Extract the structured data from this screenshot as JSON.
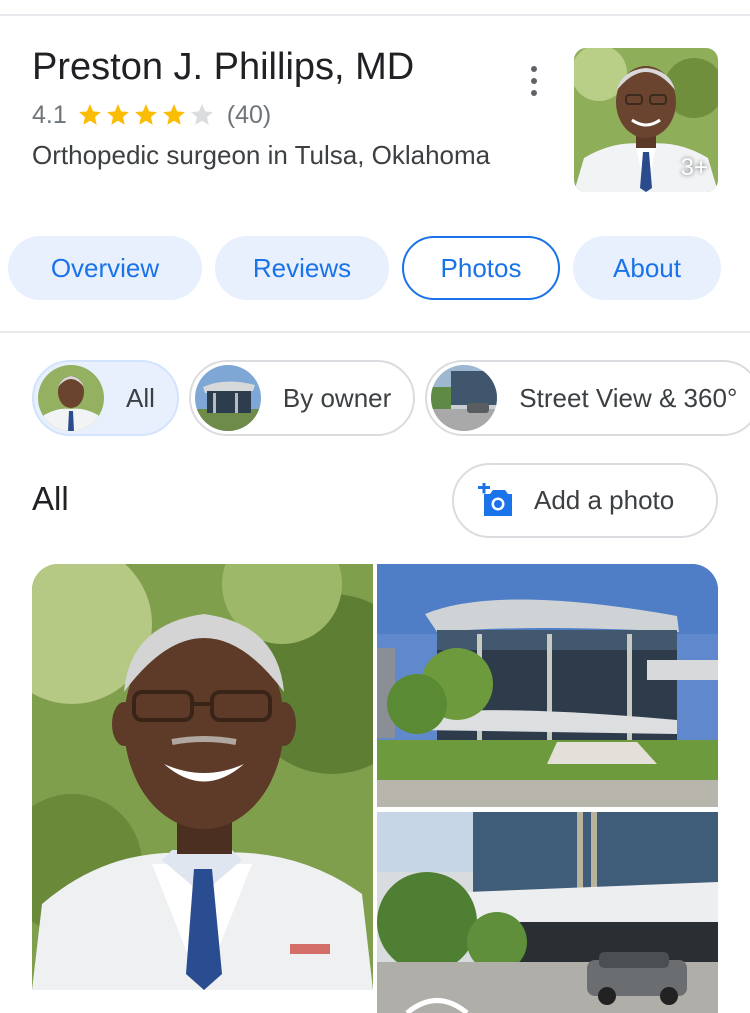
{
  "header": {
    "title": "Preston J. Phillips, MD",
    "rating": "4.1",
    "rating_value": 4.1,
    "stars_max": 5,
    "review_count": "(40)",
    "category": "Orthopedic surgeon in Tulsa, Oklahoma",
    "thumb_more": "3+"
  },
  "tabs": [
    {
      "label": "Overview",
      "active": false
    },
    {
      "label": "Reviews",
      "active": false
    },
    {
      "label": "Photos",
      "active": true
    },
    {
      "label": "About",
      "active": false
    }
  ],
  "chips": [
    {
      "label": "All",
      "selected": true
    },
    {
      "label": "By owner",
      "selected": false
    },
    {
      "label": "Street View & 360°",
      "selected": false
    }
  ],
  "section": {
    "heading": "All",
    "add_photo_label": "Add a photo"
  },
  "colors": {
    "accent": "#1a73e8",
    "tab_bg": "#e8f0fe",
    "star": "#fbbc04",
    "star_empty": "#dadce0"
  }
}
